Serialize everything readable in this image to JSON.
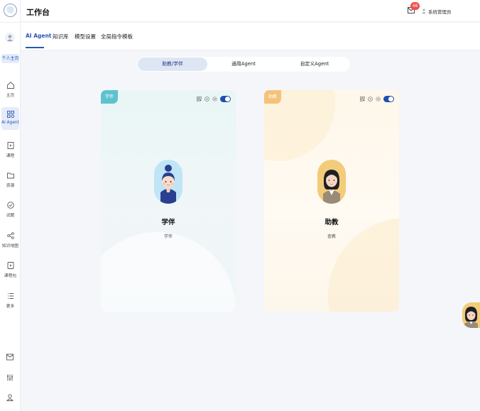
{
  "header": {
    "title": "工作台",
    "badge_count": "48",
    "user_name": "系统管理员"
  },
  "rail": {
    "me_tag": "个人主页",
    "items": [
      {
        "label": "主页",
        "icon": "home-icon"
      },
      {
        "label": "AI Agent",
        "icon": "agent-icon"
      },
      {
        "label": "课程",
        "icon": "course-icon"
      },
      {
        "label": "资源",
        "icon": "folder-icon"
      },
      {
        "label": "试题",
        "icon": "quiz-icon"
      },
      {
        "label": "知识地图",
        "icon": "knowledge-map-icon"
      },
      {
        "label": "课程包",
        "icon": "package-icon"
      },
      {
        "label": "更多",
        "icon": "more-icon"
      }
    ],
    "bottom_icons": [
      "message-icon",
      "settings-sliders-icon",
      "user-icon"
    ]
  },
  "subnav": {
    "tabs": [
      "AI Agent",
      "知识库",
      "模型设置",
      "全局指令模板"
    ],
    "active_index": 0
  },
  "segment": {
    "options": [
      "助教/学伴",
      "通用Agent",
      "自定义Agent"
    ],
    "active_index": 0
  },
  "cards": [
    {
      "tag": "学伴",
      "name": "学伴",
      "desc": "学伴",
      "enabled": true,
      "theme": "#5ec1d0"
    },
    {
      "tag": "助教",
      "name": "助教",
      "desc": "查教",
      "enabled": true,
      "theme": "#f5c27a"
    }
  ],
  "colors": {
    "accent": "#2b55b8",
    "badge": "#f04a4a",
    "toggle": "#1e4fb0"
  }
}
